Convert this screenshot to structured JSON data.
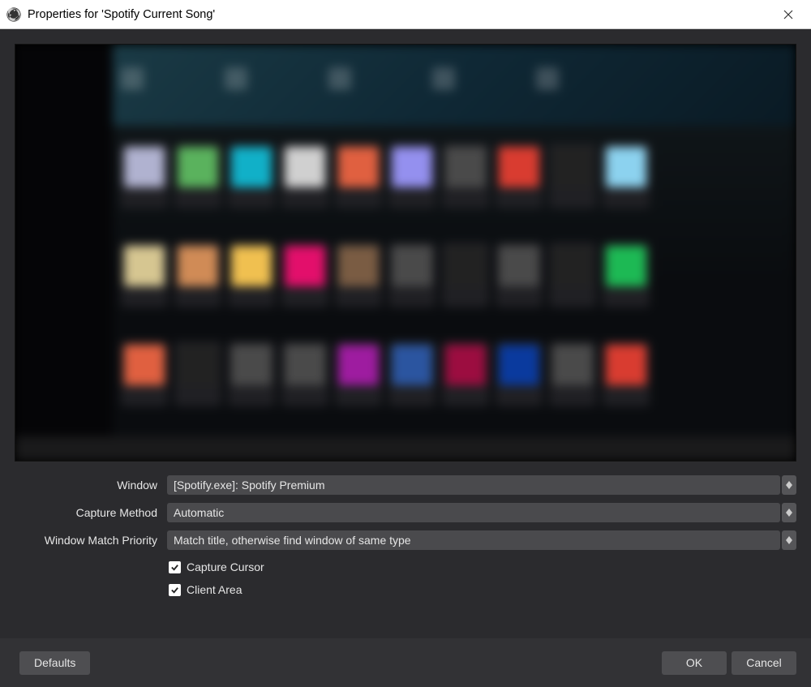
{
  "titlebar": {
    "title": "Properties for 'Spotify Current Song'"
  },
  "form": {
    "window_label": "Window",
    "window_value": "[Spotify.exe]: Spotify Premium",
    "capture_method_label": "Capture Method",
    "capture_method_value": "Automatic",
    "priority_label": "Window Match Priority",
    "priority_value": "Match title, otherwise find window of same type",
    "capture_cursor_label": "Capture Cursor",
    "capture_cursor_checked": true,
    "client_area_label": "Client Area",
    "client_area_checked": true
  },
  "footer": {
    "defaults": "Defaults",
    "ok": "OK",
    "cancel": "Cancel"
  }
}
